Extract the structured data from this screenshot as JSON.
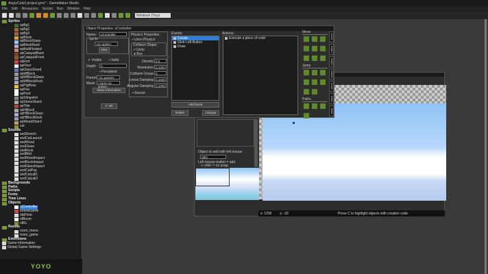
{
  "window": {
    "title": "AngryCats2.project.gmx* - GameMaker:Studio"
  },
  "menu": [
    "File",
    "Edit",
    "Resources",
    "Scripts",
    "Run",
    "Window",
    "Help"
  ],
  "toolbar": {
    "target": "Windows (Yoyo Runner)"
  },
  "tree": {
    "sprites_label": "Sprites",
    "sprites": [
      "spBg1",
      "spBg2",
      "spBg3",
      "spBlock",
      "spBlockGlass",
      "spBlockRock",
      "spBuiltFloated",
      "spCatapultBack",
      "spCatapultFront",
      "spEnd",
      "spFloor",
      "spGlassShard",
      "spWBlock",
      "spWBlockGlass",
      "spWBlockRock",
      "spPigBoss",
      "spPoe",
      "spPoof",
      "spSlingshot",
      "spStoneShard",
      "spTitle",
      "spHBlock",
      "spHBlockGlass",
      "spHBlockRock",
      "spWoodShard"
    ],
    "sprites_extra": "cat",
    "sounds_label": "Sounds",
    "sounds": [
      "sndStretch",
      "sndCatLaunch",
      "sndWood",
      "sndGlass",
      "sndRock",
      "sndBird",
      "sndWoodImpact",
      "sndRockImpact",
      "sndGlassImpact",
      "sndCatPop",
      "sndCatcall1",
      "sndCatcall2"
    ],
    "categories": [
      "Backgrounds",
      "Paths",
      "Scripts",
      "Fonts",
      "Time Lines"
    ],
    "objects_label": "Objects",
    "objects": [
      "oController",
      "oViewGame",
      "objFloor",
      "oBloom",
      "oBG"
    ],
    "selected_object": "oController",
    "rooms_label": "Rooms",
    "rooms": [
      "room_menu",
      "room_game"
    ],
    "footer": [
      "Extensions",
      "Game Information",
      "Global Game Settings"
    ]
  },
  "logo": "YOYO",
  "object_props": {
    "title": "Object Properties: oController",
    "name_label": "Name:",
    "name_value": "oController",
    "sprite_group": "Sprite",
    "sprite_value": "<no sprite>",
    "new_button": "New",
    "visible_label": "Visible",
    "solid_label": "Solid",
    "depth_label": "Depth:",
    "depth_value": "0",
    "persistent_label": "Persistent",
    "parent_label": "Parent:",
    "parent_value": "<no parent>",
    "mask_label": "Mask:",
    "mask_value": "<same as sprite>",
    "show_info_button": "Show Information",
    "ok_button": "OK",
    "physics_group": "Physics Properties",
    "uses_physics": "Uses Physics",
    "collision_shape": "Collision Shape",
    "circle": "Circle",
    "box": "Box",
    "fields": [
      {
        "label": "Density",
        "value": "0.5"
      },
      {
        "label": "Restitution",
        "value": "0.100000"
      },
      {
        "label": "Collision Group",
        "value": "0"
      },
      {
        "label": "Linear Damping",
        "value": "0.100000"
      },
      {
        "label": "Angular Damping",
        "value": "0.100000"
      }
    ],
    "sensor": "Sensor",
    "events_label": "Events:",
    "events": [
      "Create",
      "Glob Left Button",
      "Draw"
    ],
    "add_event": "Add Event",
    "delete": "Delete",
    "change": "Change",
    "actions_label": "Actions:",
    "actions": [
      "Execute a piece of code"
    ],
    "action_groups": [
      "Move",
      "Jump",
      "Paths"
    ],
    "tabs": [
      "move",
      "main1",
      "main2",
      "control",
      "score",
      "extra",
      "draw"
    ]
  },
  "room_editor": {
    "object_label": "Object to add with left mouse",
    "object_value": "oBG",
    "hint1": "Left mouse button = add",
    "hint2": "+ <Alt> = no snap",
    "x_readout": "x: 1256",
    "y_readout": "y: -32",
    "status": "Press C to highlight objects with creation code"
  }
}
